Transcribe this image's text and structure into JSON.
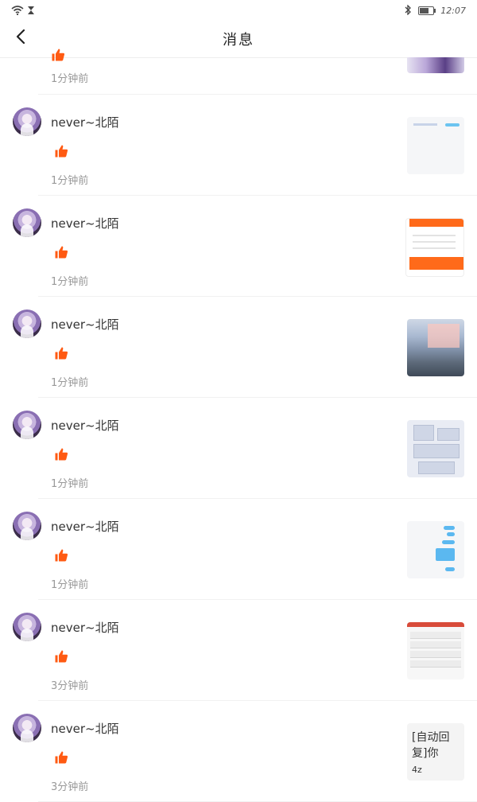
{
  "status_bar": {
    "time": "12:07",
    "battery_level": 0.7,
    "icons": [
      "wifi-icon",
      "hourglass-icon",
      "bluetooth-icon",
      "battery-icon"
    ]
  },
  "header": {
    "title": "消息",
    "back_icon": "chevron-left-icon"
  },
  "colors": {
    "like_orange": "#ff5a12",
    "divider": "#f1f1f1",
    "meta_gray": "#999999"
  },
  "partial_item": {
    "time": "1分钟前"
  },
  "items": [
    {
      "name": "never~北陌",
      "time": "1分钟前"
    },
    {
      "name": "never~北陌",
      "time": "1分钟前"
    },
    {
      "name": "never~北陌",
      "time": "1分钟前"
    },
    {
      "name": "never~北陌",
      "time": "1分钟前"
    },
    {
      "name": "never~北陌",
      "time": "1分钟前"
    },
    {
      "name": "never~北陌",
      "time": "3分钟前"
    },
    {
      "name": "never~北陌",
      "time": "3分钟前",
      "thumb_text": "[自动回复]你",
      "thumb_text_small": "4z"
    }
  ]
}
